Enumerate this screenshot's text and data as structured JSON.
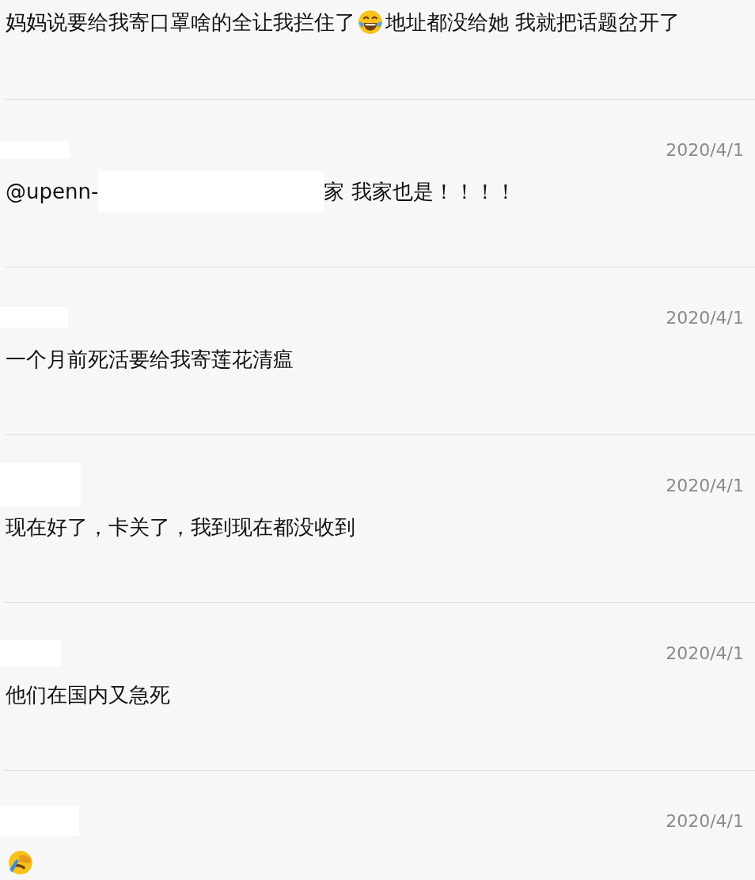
{
  "comments": [
    {
      "body": [
        {
          "kind": "text",
          "text": "妈妈说要给我寄口罩啥的全让我拦住了"
        },
        {
          "kind": "laugh-emoji"
        },
        {
          "kind": "text",
          "text": "地址都没给她 我就把话题岔开了"
        }
      ]
    },
    {
      "date": "2020/4/1",
      "body": [
        {
          "kind": "text",
          "text": "@upenn-"
        },
        {
          "kind": "redacted"
        },
        {
          "kind": "text",
          "text": "家 我家也是！！！！"
        }
      ]
    },
    {
      "date": "2020/4/1",
      "body": [
        {
          "kind": "text",
          "text": "一个月前死活要给我寄莲花清瘟"
        }
      ]
    },
    {
      "date": "2020/4/1",
      "body": [
        {
          "kind": "text",
          "text": "现在好了，卡关了，我到现在都没收到"
        }
      ]
    },
    {
      "date": "2020/4/1",
      "body": [
        {
          "kind": "text",
          "text": "他们在国内又急死"
        }
      ]
    },
    {
      "date": "2020/4/1",
      "body": [
        {
          "kind": "facepalm-emoji"
        }
      ]
    }
  ]
}
